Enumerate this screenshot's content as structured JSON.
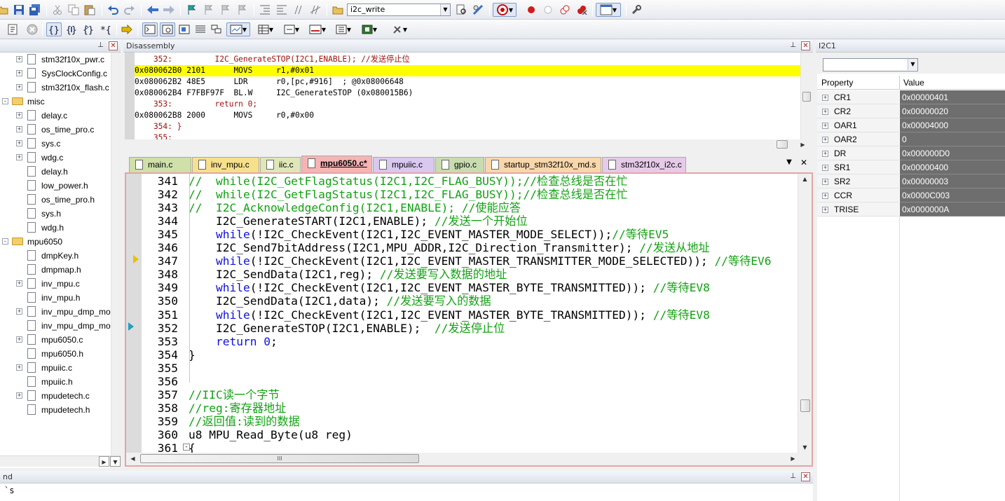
{
  "toolbar1": {
    "target_combo_value": "i2c_write",
    "icons": [
      "open-file-icon",
      "save-icon",
      "save-all-icon",
      "cut-icon",
      "copy-icon",
      "paste-icon",
      "undo-icon",
      "redo-icon",
      "nav-back-icon",
      "nav-forward-icon",
      "bookmark-toggle-icon",
      "bookmark-prev-icon",
      "bookmark-next-icon",
      "bookmark-clear-icon",
      "indent-icon",
      "unindent-icon",
      "comment-icon",
      "uncomment-icon",
      "find-in-files-icon",
      "find-icon",
      "incremental-find-icon",
      "debug-session-icon",
      "breakpoint-insert-icon",
      "breakpoint-disable-icon",
      "breakpoint-disable-all-icon",
      "breakpoint-kill-all-icon",
      "window-layout-icon",
      "configure-icon"
    ]
  },
  "toolbar2": {
    "icons": [
      "reset-icon",
      "stop-icon",
      "step-into-icon",
      "step-over-icon",
      "step-out-icon",
      "run-to-cursor-icon",
      "show-next-statement-icon",
      "command-window-icon",
      "disassembly-window-icon",
      "symbols-window-icon",
      "registers-window-icon",
      "call-stack-icon",
      "watch-window-icon",
      "memory-window-icon",
      "serial-window-icon",
      "analysis-window-icon",
      "trace-window-icon",
      "system-viewer-icon",
      "toolbox-icon"
    ]
  },
  "project_tree": {
    "items": [
      {
        "label": "stm32f10x_pwr.c",
        "type": "file",
        "expandable": true
      },
      {
        "label": "SysClockConfig.c",
        "type": "file",
        "expandable": true
      },
      {
        "label": "stm32f10x_flash.c",
        "type": "file",
        "expandable": true
      },
      {
        "label": "misc",
        "type": "folder",
        "expandable": true
      },
      {
        "label": "delay.c",
        "type": "file",
        "expandable": true
      },
      {
        "label": "os_time_pro.c",
        "type": "file",
        "expandable": true
      },
      {
        "label": "sys.c",
        "type": "file",
        "expandable": true
      },
      {
        "label": "wdg.c",
        "type": "file",
        "expandable": true
      },
      {
        "label": "delay.h",
        "type": "file",
        "expandable": false
      },
      {
        "label": "low_power.h",
        "type": "file",
        "expandable": false
      },
      {
        "label": "os_time_pro.h",
        "type": "file",
        "expandable": false
      },
      {
        "label": "sys.h",
        "type": "file",
        "expandable": false
      },
      {
        "label": "wdg.h",
        "type": "file",
        "expandable": false
      },
      {
        "label": "mpu6050",
        "type": "folder",
        "expandable": true
      },
      {
        "label": "dmpKey.h",
        "type": "file",
        "expandable": false
      },
      {
        "label": "dmpmap.h",
        "type": "file",
        "expandable": false
      },
      {
        "label": "inv_mpu.c",
        "type": "file",
        "expandable": true
      },
      {
        "label": "inv_mpu.h",
        "type": "file",
        "expandable": false
      },
      {
        "label": "inv_mpu_dmp_mo",
        "type": "file",
        "expandable": true
      },
      {
        "label": "inv_mpu_dmp_mo",
        "type": "file",
        "expandable": false
      },
      {
        "label": "mpu6050.c",
        "type": "file",
        "expandable": true
      },
      {
        "label": "mpu6050.h",
        "type": "file",
        "expandable": false
      },
      {
        "label": "mpuiic.c",
        "type": "file",
        "expandable": true
      },
      {
        "label": "mpuiic.h",
        "type": "file",
        "expandable": false
      },
      {
        "label": "mpudetech.c",
        "type": "file",
        "expandable": true
      },
      {
        "label": "mpudetech.h",
        "type": "file",
        "expandable": false
      }
    ]
  },
  "disassembly": {
    "title": "Disassembly",
    "lines": [
      {
        "text": "    352:         I2C_GenerateSTOP(I2C1,ENABLE); //发送停止位",
        "kind": "src"
      },
      {
        "text": "0x080062B0 2101      MOVS     r1,#0x01",
        "kind": "current"
      },
      {
        "text": "0x080062B2 48E5      LDR      r0,[pc,#916]  ; @0x08006648",
        "kind": "asm"
      },
      {
        "text": "0x080062B4 F7FBF97F  BL.W     I2C_GenerateSTOP (0x080015B6)",
        "kind": "asm"
      },
      {
        "text": "    353:         return 0;",
        "kind": "src"
      },
      {
        "text": "0x080062B8 2000      MOVS     r0,#0x00",
        "kind": "asm"
      },
      {
        "text": "    354: }",
        "kind": "src"
      },
      {
        "text": "    355:",
        "kind": "src"
      }
    ]
  },
  "tabs": [
    {
      "label": "main.c",
      "color": "#cfe0a9",
      "active": false
    },
    {
      "label": "inv_mpu.c",
      "color": "#f7e08c",
      "active": false
    },
    {
      "label": "iic.c",
      "color": "#dfe7b8",
      "active": false
    },
    {
      "label": "mpu6050.c*",
      "color": "#f6b4b4",
      "active": true
    },
    {
      "label": "mpuiic.c",
      "color": "#d9c8ef",
      "active": false
    },
    {
      "label": "gpio.c",
      "color": "#c9dcb0",
      "active": false
    },
    {
      "label": "startup_stm32f10x_md.s",
      "color": "#f8d7ab",
      "active": false
    },
    {
      "label": "stm32f10x_i2c.c",
      "color": "#e6cbe8",
      "active": false
    }
  ],
  "editor": {
    "lines": [
      {
        "n": "341",
        "parts": [
          [
            "cm",
            "//  while(I2C_GetFlagStatus(I2C1,I2C_FLAG_BUSY));//检查总线是否在忙"
          ]
        ]
      },
      {
        "n": "342",
        "parts": [
          [
            "cm",
            "//  while(I2C_GetFlagStatus(I2C1,I2C_FLAG_BUSY));//检查总线是否在忙"
          ]
        ]
      },
      {
        "n": "343",
        "parts": [
          [
            "cm",
            "//  I2C_AcknowledgeConfig(I2C1,ENABLE); //使能应答"
          ]
        ]
      },
      {
        "n": "344",
        "parts": [
          [
            "",
            "    I2C_GenerateSTART(I2C1,ENABLE); "
          ],
          [
            "cm",
            "//发送一个开始位"
          ]
        ]
      },
      {
        "n": "345",
        "parts": [
          [
            "",
            "    "
          ],
          [
            "kw",
            "while"
          ],
          [
            "",
            "(!I2C_CheckEvent(I2C1,I2C_EVENT_MASTER_MODE_SELECT));"
          ],
          [
            "cm",
            "//等待EV5"
          ]
        ]
      },
      {
        "n": "346",
        "parts": [
          [
            "",
            "    I2C_Send7bitAddress(I2C1,MPU_ADDR,I2C_Direction_Transmitter); "
          ],
          [
            "cm",
            "//发送从地址"
          ]
        ]
      },
      {
        "n": "347",
        "parts": [
          [
            "",
            "    "
          ],
          [
            "kw",
            "while"
          ],
          [
            "",
            "(!I2C_CheckEvent(I2C1,I2C_EVENT_MASTER_TRANSMITTER_MODE_SELECTED)); "
          ],
          [
            "cm",
            "//等待EV6"
          ]
        ]
      },
      {
        "n": "348",
        "parts": [
          [
            "",
            "    I2C_SendData(I2C1,reg); "
          ],
          [
            "cm",
            "//发送要写入数据的地址"
          ]
        ]
      },
      {
        "n": "349",
        "parts": [
          [
            "",
            "    "
          ],
          [
            "kw",
            "while"
          ],
          [
            "",
            "(!I2C_CheckEvent(I2C1,I2C_EVENT_MASTER_BYTE_TRANSMITTED)); "
          ],
          [
            "cm",
            "//等待EV8"
          ]
        ]
      },
      {
        "n": "350",
        "parts": [
          [
            "",
            "    I2C_SendData(I2C1,data); "
          ],
          [
            "cm",
            "//发送要写入的数据"
          ]
        ]
      },
      {
        "n": "351",
        "parts": [
          [
            "",
            "    "
          ],
          [
            "kw",
            "while"
          ],
          [
            "",
            "(!I2C_CheckEvent(I2C1,I2C_EVENT_MASTER_BYTE_TRANSMITTED)); "
          ],
          [
            "cm",
            "//等待EV8"
          ]
        ]
      },
      {
        "n": "352",
        "parts": [
          [
            "",
            "    I2C_GenerateSTOP(I2C1,ENABLE);  "
          ],
          [
            "cm",
            "//发送停止位"
          ]
        ]
      },
      {
        "n": "353",
        "parts": [
          [
            "",
            "    "
          ],
          [
            "kw",
            "return"
          ],
          [
            "",
            " "
          ],
          [
            "num",
            "0"
          ],
          [
            "",
            ";"
          ]
        ]
      },
      {
        "n": "354",
        "parts": [
          [
            "",
            "}"
          ]
        ]
      },
      {
        "n": "355",
        "parts": [
          [
            "",
            ""
          ]
        ]
      },
      {
        "n": "356",
        "parts": [
          [
            "",
            ""
          ]
        ]
      },
      {
        "n": "357",
        "parts": [
          [
            "cm",
            "//IIC读一个字节"
          ]
        ]
      },
      {
        "n": "358",
        "parts": [
          [
            "cm",
            "//reg:寄存器地址"
          ]
        ]
      },
      {
        "n": "359",
        "parts": [
          [
            "cm",
            "//返回值:读到的数据"
          ]
        ]
      },
      {
        "n": "360",
        "parts": [
          [
            "",
            "u8 MPU_Read_Byte(u8 reg)"
          ]
        ]
      },
      {
        "n": "361",
        "parts": [
          [
            "",
            "{"
          ]
        ]
      }
    ],
    "hscroll_label": "III"
  },
  "bottom_pane": {
    "title": "nd",
    "content": "`s"
  },
  "peripheral": {
    "title": "I2C1",
    "combo_value": "",
    "header_property": "Property",
    "header_value": "Value",
    "rows": [
      {
        "name": "CR1",
        "value": "0x00000401"
      },
      {
        "name": "CR2",
        "value": "0x00000020"
      },
      {
        "name": "OAR1",
        "value": "0x00004000"
      },
      {
        "name": "OAR2",
        "value": "0"
      },
      {
        "name": "DR",
        "value": "0x000000D0"
      },
      {
        "name": "SR1",
        "value": "0x00000400"
      },
      {
        "name": "SR2",
        "value": "0x00000003"
      },
      {
        "name": "CCR",
        "value": "0x0000C003"
      },
      {
        "name": "TRISE",
        "value": "0x0000000A"
      }
    ]
  },
  "colors": {
    "current_line_highlight": "#ffff00",
    "comment_green": "#12a212",
    "keyword_blue": "#1010e0",
    "editor_border": "#e6a4a4",
    "register_value_bg": "#6e6e6e"
  }
}
